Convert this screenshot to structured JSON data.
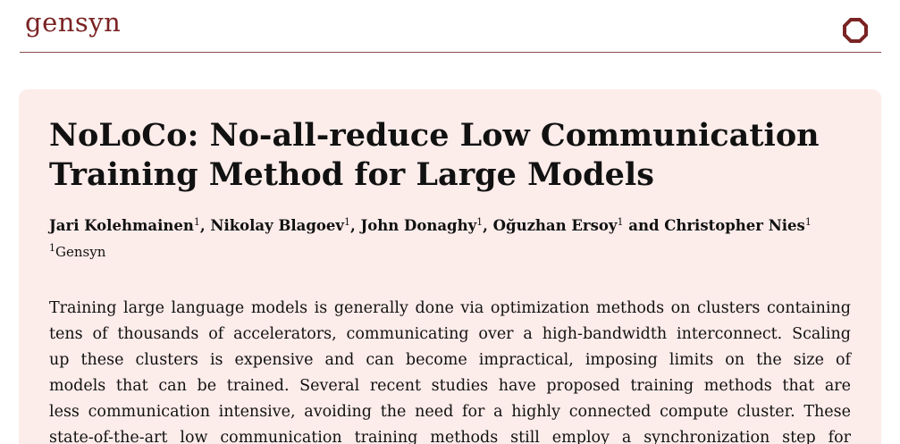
{
  "header": {
    "brand": "gensyn",
    "logo_icon": "gensyn-logo-icon",
    "brand_color": "#7a2323"
  },
  "paper": {
    "title_lines": [
      "NoLoCo: No-all-reduce Low Communication",
      "Training Method for Large Models"
    ],
    "authors": [
      {
        "name": "Jari Kolehmainen",
        "affil": "1"
      },
      {
        "name": "Nikolay Blagoev",
        "affil": "1"
      },
      {
        "name": "John Donaghy",
        "affil": "1"
      },
      {
        "name": "Oğuzhan Ersoy",
        "affil": "1"
      },
      {
        "name": "Christopher Nies",
        "affil": "1"
      }
    ],
    "author_separators": [
      ", ",
      ", ",
      ", ",
      " and "
    ],
    "affiliation": {
      "mark": "1",
      "name": "Gensyn"
    },
    "abstract_lines": [
      "Training large language models is generally done via optimization methods on clusters containing",
      "tens of thousands of accelerators, communicating over a high-bandwidth interconnect. Scaling",
      "up these clusters is expensive and can become impractical, imposing limits on the size of",
      "models that can be trained. Several recent studies have proposed training methods that are",
      "less communication intensive, avoiding the need for a highly connected compute cluster. These",
      "state-of-the-art low communication training methods still employ a synchronization step for"
    ],
    "card_color": "#fcecea"
  }
}
